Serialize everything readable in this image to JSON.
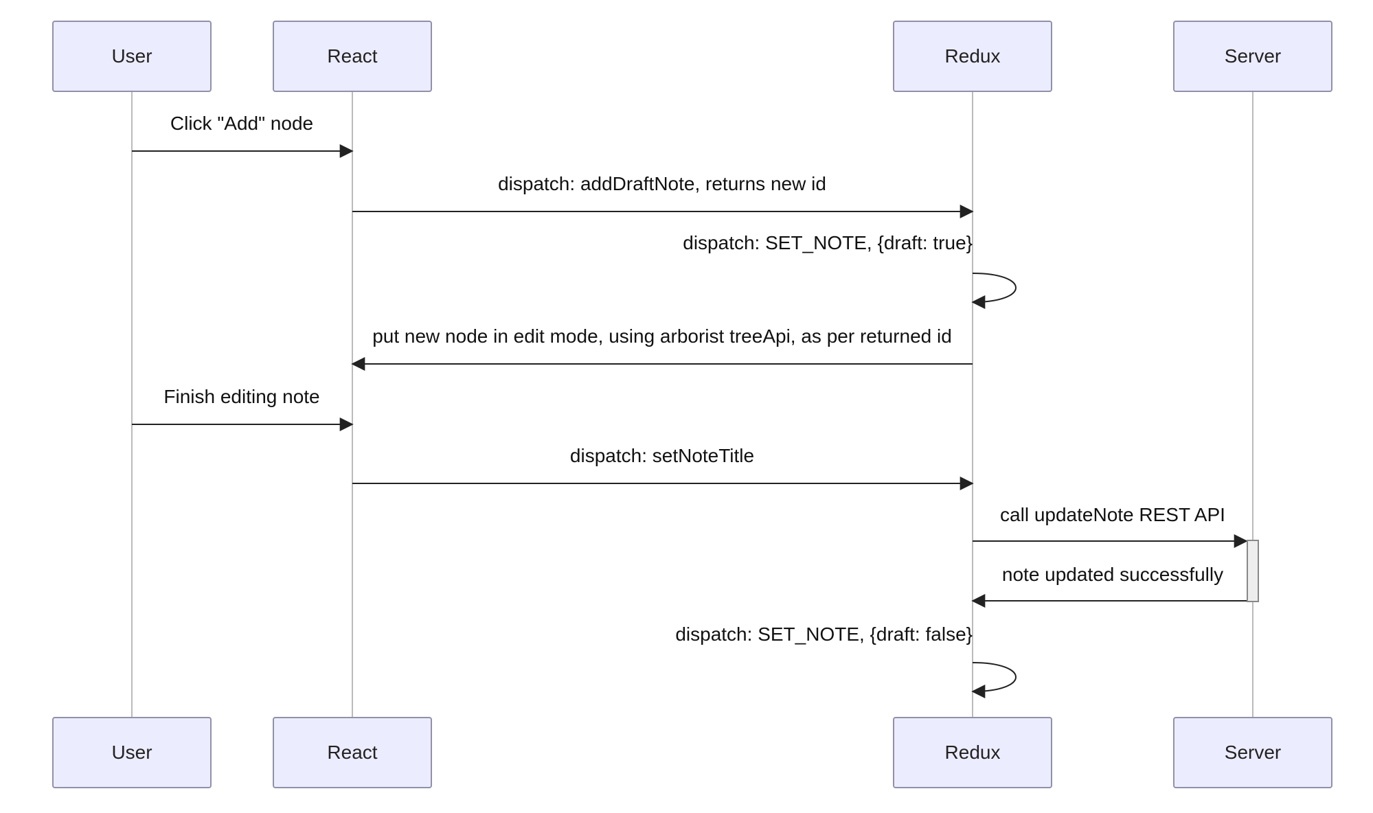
{
  "participants": {
    "user": {
      "label": "User"
    },
    "react": {
      "label": "React"
    },
    "redux": {
      "label": "Redux"
    },
    "server": {
      "label": "Server"
    }
  },
  "messages": {
    "m1": {
      "text": "Click \"Add\" node"
    },
    "m2": {
      "text": "dispatch: addDraftNote, returns new id"
    },
    "m3": {
      "text": "dispatch: SET_NOTE, {draft: true}"
    },
    "m4": {
      "text": "put new node in edit mode, using arborist treeApi, as per returned id"
    },
    "m5": {
      "text": "Finish editing note"
    },
    "m6": {
      "text": "dispatch: setNoteTitle"
    },
    "m7": {
      "text": "call updateNote REST API"
    },
    "m8": {
      "text": "note updated successfully"
    },
    "m9": {
      "text": "dispatch: SET_NOTE, {draft: false}"
    }
  },
  "chart_data": {
    "type": "sequence-diagram",
    "participants": [
      "User",
      "React",
      "Redux",
      "Server"
    ],
    "interactions": [
      {
        "from": "User",
        "to": "React",
        "label": "Click \"Add\" node",
        "kind": "sync"
      },
      {
        "from": "React",
        "to": "Redux",
        "label": "dispatch: addDraftNote, returns new id",
        "kind": "sync"
      },
      {
        "from": "Redux",
        "to": "Redux",
        "label": "dispatch: SET_NOTE, {draft: true}",
        "kind": "self"
      },
      {
        "from": "Redux",
        "to": "React",
        "label": "put new node in edit mode, using arborist treeApi, as per returned id",
        "kind": "sync"
      },
      {
        "from": "User",
        "to": "React",
        "label": "Finish editing note",
        "kind": "sync"
      },
      {
        "from": "React",
        "to": "Redux",
        "label": "dispatch: setNoteTitle",
        "kind": "sync"
      },
      {
        "from": "Redux",
        "to": "Server",
        "label": "call updateNote REST API",
        "kind": "sync"
      },
      {
        "from": "Server",
        "to": "Redux",
        "label": "note updated successfully",
        "kind": "sync"
      },
      {
        "from": "Redux",
        "to": "Redux",
        "label": "dispatch: SET_NOTE, {draft: false}",
        "kind": "self"
      }
    ]
  }
}
